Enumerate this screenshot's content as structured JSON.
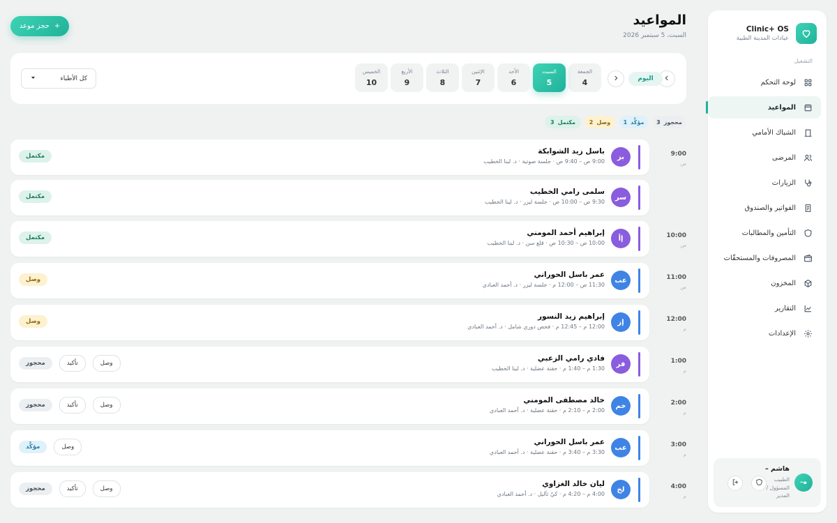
{
  "sidebar": {
    "brand_name": "Clinic+ OS",
    "brand_sub": "عيادات المدينة الطبية",
    "section_label": "التشغيل",
    "items": [
      {
        "label": "لوحة التحكم",
        "icon": "grid-icon"
      },
      {
        "label": "المواعيد",
        "icon": "calendar-icon"
      },
      {
        "label": "الشباك الأمامي",
        "icon": "door-icon"
      },
      {
        "label": "المرضى",
        "icon": "users-icon"
      },
      {
        "label": "الزيارات",
        "icon": "stethoscope-icon"
      },
      {
        "label": "الفواتير والصندوق",
        "icon": "invoice-icon"
      },
      {
        "label": "التأمين والمطالبات",
        "icon": "shield-icon"
      },
      {
        "label": "المصروفات والمستحقّات",
        "icon": "wallet-icon"
      },
      {
        "label": "المخزون",
        "icon": "box-icon"
      },
      {
        "label": "التقارير",
        "icon": "chart-icon"
      },
      {
        "label": "الإعدادات",
        "icon": "gear-icon"
      }
    ],
    "active_index": 1,
    "user": {
      "initials": "ه–",
      "name": "هاشم –",
      "role": "الطبيب المسؤول / المدير"
    }
  },
  "header": {
    "title": "المواعيد",
    "date": "السبت، 5 سبتمبر 2026",
    "book_button": "حجز موعد"
  },
  "date_strip": {
    "today_label": "اليوم",
    "days": [
      {
        "name": "الجمعة",
        "num": "4"
      },
      {
        "name": "السبت",
        "num": "5",
        "active": true
      },
      {
        "name": "الأحد",
        "num": "6"
      },
      {
        "name": "الإثنين",
        "num": "7"
      },
      {
        "name": "الثلاث",
        "num": "8"
      },
      {
        "name": "الأربع",
        "num": "9"
      },
      {
        "name": "الخميس",
        "num": "10"
      }
    ],
    "doctor_filter": "كل الأطباء"
  },
  "summary": [
    {
      "label": "محجوز",
      "count": "3",
      "color": "#475059"
    },
    {
      "label": "مؤكَّد",
      "count": "1",
      "color": "#2a7ea0"
    },
    {
      "label": "وصل",
      "count": "2",
      "color": "#8b6a12"
    },
    {
      "label": "مكتمل",
      "count": "3",
      "color": "#1c7a63"
    }
  ],
  "time_labels": [
    {
      "time": "9:00",
      "period": "ص"
    },
    {
      "time": "10:00",
      "period": "ص"
    },
    {
      "time": "11:00",
      "period": "ص"
    },
    {
      "time": "12:00",
      "period": "م"
    },
    {
      "time": "1:00",
      "period": "م"
    },
    {
      "time": "2:00",
      "period": "م"
    },
    {
      "time": "3:00",
      "period": "م"
    },
    {
      "time": "4:00",
      "period": "م"
    }
  ],
  "appointments": [
    {
      "initials": "بز",
      "name": "باسل زيد الشوابكة",
      "detail": "9:00 ص – 9:40 ص · جلسة صوتية · د. لينا الخطيب",
      "status": "مكتمل",
      "color": "#8a5cde"
    },
    {
      "initials": "سر",
      "name": "سلمى رامي الخطيب",
      "detail": "9:30 ص – 10:00 ص · جلسة ليزر · د. لينا الخطيب",
      "status": "مكتمل",
      "color": "#8a5cde"
    },
    {
      "initials": "إأ",
      "name": "إبراهيم أحمد المومني",
      "detail": "10:00 ص – 10:30 ص · قلع سن · د. لينا الخطيب",
      "status": "مكتمل",
      "color": "#8a5cde"
    },
    {
      "initials": "عب",
      "name": "عمر باسل الحوراني",
      "detail": "11:30 ص – 12:00 م · جلسة ليزر · د. أحمد العبادي",
      "status": "وصل",
      "color": "#3f84e5"
    },
    {
      "initials": "إز",
      "name": "إبراهيم زيد النسور",
      "detail": "12:00 م – 12:45 م · فحص دوري شامل · د. أحمد العبادي",
      "status": "وصل",
      "color": "#3f84e5"
    },
    {
      "initials": "فر",
      "name": "فادي رامي الزعبي",
      "detail": "1:30 م – 1:40 م · حقنة عضلية · د. لينا الخطيب",
      "status": "محجوز",
      "confirm": "تأكيد",
      "arrive": "وصل",
      "color": "#8a5cde"
    },
    {
      "initials": "خم",
      "name": "خالد مصطفى المومني",
      "detail": "2:00 م – 2:10 م · حقنة عضلية · د. أحمد العبادي",
      "status": "محجوز",
      "confirm": "تأكيد",
      "arrive": "وصل",
      "color": "#3f84e5"
    },
    {
      "initials": "عب",
      "name": "عمر باسل الحوراني",
      "detail": "3:30 م – 3:40 م · حقنة عضلية · د. أحمد العبادي",
      "status": "مؤكَّد",
      "arrive": "وصل",
      "color": "#3f84e5"
    },
    {
      "initials": "لخ",
      "name": "ليان خالد الغزاوي",
      "detail": "4:00 م – 4:20 م · كيّ ثآليل · د. أحمد العبادي",
      "status": "محجوز",
      "confirm": "تأكيد",
      "arrive": "وصل",
      "color": "#3f84e5"
    }
  ]
}
